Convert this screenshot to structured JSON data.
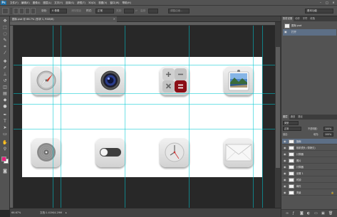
{
  "menubar": {
    "logo": "Ps",
    "items": [
      "文件(F)",
      "编辑(E)",
      "图像(I)",
      "图层(L)",
      "文字(Y)",
      "选择(S)",
      "滤镜(T)",
      "3D(D)",
      "视图(V)",
      "窗口(W)",
      "帮助(H)"
    ],
    "window_buttons": [
      "–",
      "□",
      "✕"
    ]
  },
  "options": {
    "feather_label": "羽化:",
    "feather_value": "0 像素",
    "antialias_label": "消除锯齿",
    "style_label": "样式:",
    "style_value": "正常",
    "width_label": "宽度:",
    "height_label": "高度:",
    "refine_button": "调整边缘...",
    "workspace": "基本功能"
  },
  "document": {
    "tab_title": "图标.psd @ 66.7% (形状 1, RGB/8)",
    "tab_close": "×"
  },
  "status": {
    "zoom": "66.67%",
    "doc_info": "文档:1.41M/4.29M"
  },
  "icons": [
    {
      "name": "safari"
    },
    {
      "name": "camera"
    },
    {
      "name": "calculator"
    },
    {
      "name": "photos"
    },
    {
      "name": "music-disc"
    },
    {
      "name": "settings-toggle"
    },
    {
      "name": "clock"
    },
    {
      "name": "mail"
    }
  ],
  "panels": {
    "top_tabs": [
      "历史记录",
      "动作",
      "字符",
      "段落"
    ],
    "history": {
      "rows": [
        "图标.psd",
        "打开"
      ]
    },
    "layers_tabs": [
      "图层",
      "通道",
      "路径"
    ],
    "kind_label": "类型",
    "blend_mode": "正常",
    "opacity_label": "不透明度:",
    "opacity_value": "100%",
    "lock_label": "锁定:",
    "fill_label": "填充:",
    "fill_value": "100%",
    "layers": [
      {
        "name": "指南",
        "selected": true
      },
      {
        "name": "相机镜头 (带拷贝)",
        "selected": false
      },
      {
        "name": "计算器",
        "selected": false
      },
      {
        "name": "照片",
        "selected": false
      },
      {
        "name": "计算器",
        "selected": false
      },
      {
        "name": "设置 1",
        "selected": false
      },
      {
        "name": "时钟",
        "selected": false
      },
      {
        "name": "邮件",
        "selected": false
      },
      {
        "name": "背景",
        "selected": false
      }
    ]
  },
  "colors": {
    "ui_dark": "#282828",
    "ui_panel": "#535353",
    "guide": "#00c8d2",
    "selected_layer": "#5d6f86",
    "calculator_red": "#8b0f17"
  }
}
